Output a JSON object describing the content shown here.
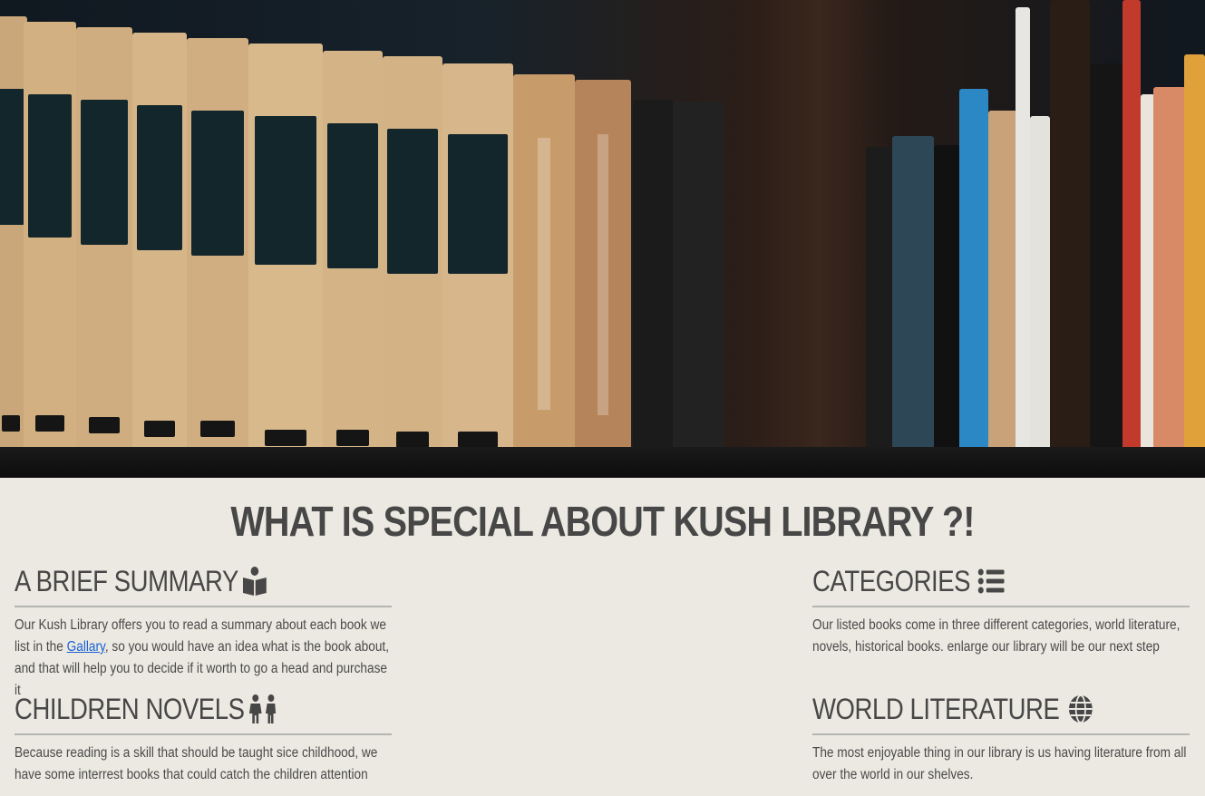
{
  "hero": {
    "image_alt": "bookshelf-photo"
  },
  "main_heading": "WHAT IS SPECIAL ABOUT KUSH LIBRARY ?!",
  "sections": {
    "summary": {
      "title": "A BRIEF SUMMARY",
      "icon": "book-reader-icon",
      "text_before_link": "Our Kush Library offers you to read a summary about each book we list in the ",
      "link_label": "Gallary",
      "text_after_link": ", so you would have an idea what is the book about, and that will help you to decide if it worth to go a head and purchase it"
    },
    "categories": {
      "title": "CATEGORIES",
      "icon": "list-icon",
      "text": "Our listed books come in three different categories, world literature, novels, historical books. enlarge our library will be our next step"
    },
    "children": {
      "title": "CHILDREN NOVELS",
      "icon": "children-icon",
      "text": "Because reading is a skill that should be taught sice childhood, we have some interrest books that could catch the children attention"
    },
    "world": {
      "title": "WORLD LITERATURE",
      "icon": "globe-icon",
      "text": "The most enjoyable thing in our library is us having literature from all over the world in our shelves."
    }
  },
  "colors": {
    "background": "#ebe9e1",
    "text": "#474747",
    "link": "#1a62d6",
    "divider": "#b5b5b0"
  }
}
